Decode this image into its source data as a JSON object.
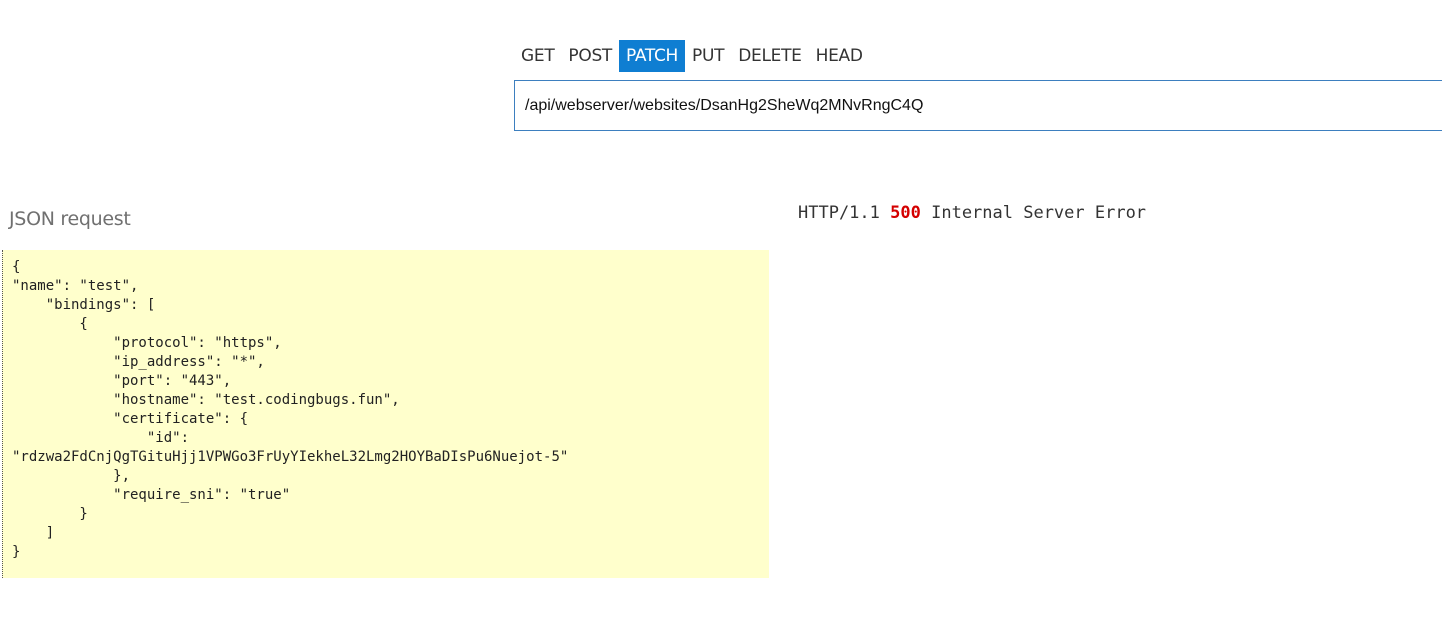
{
  "methods": [
    {
      "label": "GET",
      "active": false
    },
    {
      "label": "POST",
      "active": false
    },
    {
      "label": "PATCH",
      "active": true
    },
    {
      "label": "PUT",
      "active": false
    },
    {
      "label": "DELETE",
      "active": false
    },
    {
      "label": "HEAD",
      "active": false
    }
  ],
  "url": {
    "value": "/api/webserver/websites/DsanHg2SheWq2MNvRngC4Q"
  },
  "request": {
    "title": "JSON request",
    "body": "{\n\"name\": \"test\",\n    \"bindings\": [\n        {\n            \"protocol\": \"https\",\n            \"ip_address\": \"*\",\n            \"port\": \"443\",\n            \"hostname\": \"test.codingbugs.fun\",\n            \"certificate\": {\n                \"id\":\n\"rdzwa2FdCnjQgTGituHjj1VPWGo3FrUyYIekheL32Lmg2HOYBaDIsPu6Nuejot-5\"\n            },\n            \"require_sni\": \"true\"\n        }\n    ]\n}"
  },
  "response": {
    "protocol": "HTTP/1.1",
    "status_code": "500",
    "status_text": "Internal Server Error"
  },
  "colors": {
    "active_tab": "#0f7ed2",
    "editor_background": "#ffffcc",
    "error_code": "#d40000",
    "url_border": "#3d7fbf"
  }
}
